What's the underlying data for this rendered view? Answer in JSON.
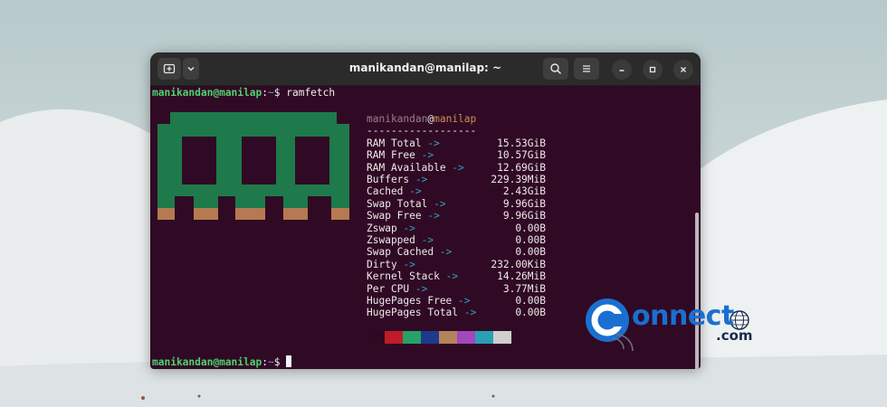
{
  "window": {
    "title": "manikandan@manilap: ~"
  },
  "terminal": {
    "prompt_user": "manikandan@manilap",
    "prompt_sep": ":",
    "prompt_path": "~",
    "prompt_symbol": "$",
    "command": " ramfetch",
    "fetch_user": "manikandan",
    "fetch_at": "@",
    "fetch_host": "manilap",
    "separator": "------------------",
    "arrow": "->",
    "rows": [
      {
        "label": "RAM Total",
        "value": "15.53GiB"
      },
      {
        "label": "RAM Free",
        "value": "10.57GiB"
      },
      {
        "label": "RAM Available",
        "value": "12.69GiB"
      },
      {
        "label": "Buffers",
        "value": "229.39MiB"
      },
      {
        "label": "Cached",
        "value": "2.43GiB"
      },
      {
        "label": "Swap Total",
        "value": "9.96GiB"
      },
      {
        "label": "Swap Free",
        "value": "9.96GiB"
      },
      {
        "label": "Zswap",
        "value": "0.00B"
      },
      {
        "label": "Zswapped",
        "value": "0.00B"
      },
      {
        "label": "Swap Cached",
        "value": "0.00B"
      },
      {
        "label": "Dirty",
        "value": "232.00KiB"
      },
      {
        "label": "Kernel Stack",
        "value": "14.26MiB"
      },
      {
        "label": "Per CPU",
        "value": "3.77MiB"
      },
      {
        "label": "HugePages Free",
        "value": "0.00B"
      },
      {
        "label": "HugePages Total",
        "value": "0.00B"
      }
    ],
    "palette": [
      "#2d0922",
      "#c01c28",
      "#26a269",
      "#1e3a8a",
      "#b5835a",
      "#a347ba",
      "#2aa1b3",
      "#d0cfcc"
    ],
    "ram_art_colors": {
      "body": "#1e7a4a",
      "pins": "#b57a52"
    }
  },
  "watermark": {
    "brand_c": "C",
    "brand_rest": "onnect",
    "brand_tld": ".com"
  },
  "icons": {
    "new_tab": "new-tab-icon",
    "dropdown": "chevron-down-icon",
    "search": "search-icon",
    "menu": "hamburger-menu-icon",
    "minimize": "minimize-icon",
    "maximize": "maximize-icon",
    "close": "close-icon"
  }
}
